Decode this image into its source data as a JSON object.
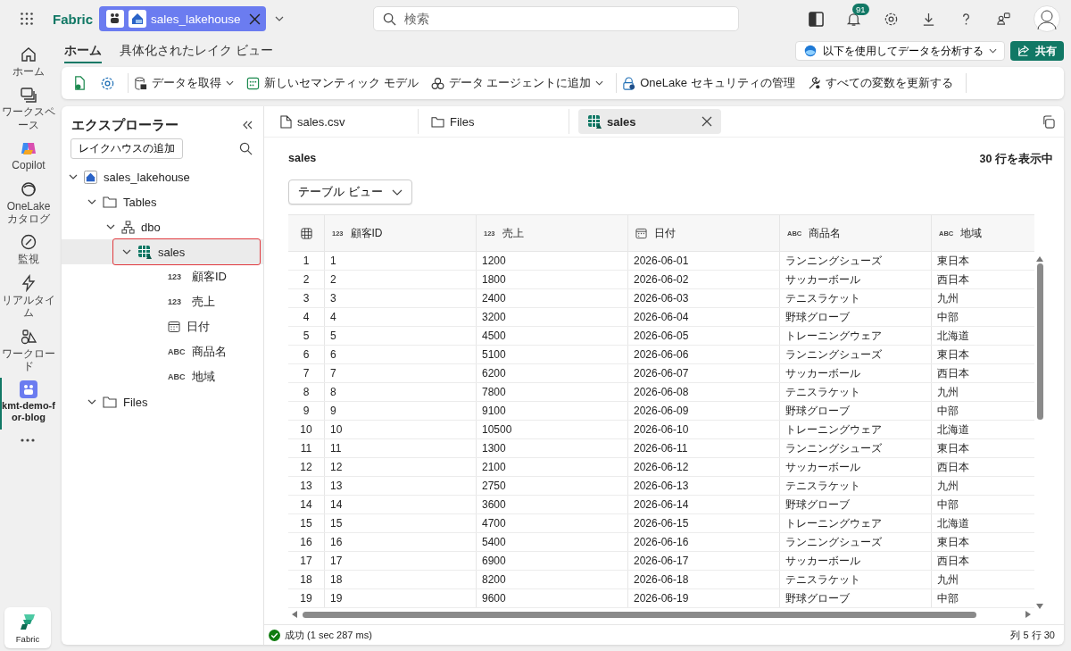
{
  "topbar": {
    "brand": "Fabric",
    "item_tab": {
      "label": "sales_lakehouse"
    },
    "search": {
      "placeholder": "検索"
    },
    "notifications": "91"
  },
  "rail": {
    "items": [
      {
        "label": "ホーム",
        "selected": false
      },
      {
        "label": "ワークスペース",
        "selected": false
      },
      {
        "label": "Copilot",
        "selected": false
      },
      {
        "label": "OneLake カタログ",
        "selected": false
      },
      {
        "label": "監視",
        "selected": false
      },
      {
        "label": "リアルタイム",
        "selected": false
      },
      {
        "label": "ワークロード",
        "selected": false
      },
      {
        "label": "kmt-demo-for-blog",
        "selected": true
      }
    ],
    "footer": "Fabric"
  },
  "ribbon_tabs": [
    {
      "label": "ホーム",
      "selected": true
    },
    {
      "label": "具体化されたレイク ビュー",
      "selected": false
    }
  ],
  "analyze_button": "以下を使用してデータを分析する",
  "share_button": "共有",
  "toolbar": [
    {
      "label": "データを取得",
      "dropdown": true
    },
    {
      "label": "新しいセマンティック モデル",
      "dropdown": false
    },
    {
      "label": "データ エージェントに追加",
      "dropdown": true
    },
    {
      "label": "OneLake セキュリティの管理",
      "dropdown": false
    },
    {
      "label": "すべての変数を更新する",
      "dropdown": false
    }
  ],
  "explorer": {
    "title": "エクスプローラー",
    "add_button": "レイクハウスの追加",
    "tree": [
      {
        "label": "sales_lakehouse",
        "kind": "lakehouse",
        "expanded": true,
        "selected": false,
        "children": [
          {
            "label": "Tables",
            "kind": "folder",
            "expanded": true,
            "selected": false,
            "children": [
              {
                "label": "dbo",
                "kind": "schema",
                "expanded": true,
                "selected": false,
                "children": [
                  {
                    "label": "sales",
                    "kind": "table",
                    "expanded": true,
                    "selected": true,
                    "children": [
                      {
                        "label": "顧客ID",
                        "kind": "column",
                        "type_label": "123",
                        "selected": false
                      },
                      {
                        "label": "売上",
                        "kind": "column",
                        "type_label": "123",
                        "selected": false
                      },
                      {
                        "label": "日付",
                        "kind": "date-column",
                        "selected": false
                      },
                      {
                        "label": "商品名",
                        "kind": "column",
                        "type_label": "ABC",
                        "selected": false
                      },
                      {
                        "label": "地域",
                        "kind": "column",
                        "type_label": "ABC",
                        "selected": false
                      }
                    ]
                  }
                ]
              }
            ]
          },
          {
            "label": "Files",
            "kind": "folder",
            "expanded": true,
            "selected": false
          }
        ]
      }
    ]
  },
  "doc_tabs": [
    {
      "label": "sales.csv",
      "kind": "file",
      "selected": false
    },
    {
      "label": "Files",
      "kind": "folder",
      "selected": false
    },
    {
      "label": "sales",
      "kind": "table",
      "selected": true
    }
  ],
  "preview": {
    "title": "sales",
    "row_count": "30 行を表示中",
    "view_select": "テーブル ビュー",
    "columns": [
      {
        "kind": "index"
      },
      {
        "name": "顧客ID",
        "kind": "number",
        "type_label": "123"
      },
      {
        "name": "売上",
        "kind": "number",
        "type_label": "123"
      },
      {
        "name": "日付",
        "kind": "date"
      },
      {
        "name": "商品名",
        "kind": "text",
        "type_label": "ABC"
      },
      {
        "name": "地域",
        "kind": "text",
        "type_label": "ABC"
      }
    ],
    "rows": [
      [
        "1",
        "1",
        "1200",
        "2026-06-01",
        "ランニングシューズ",
        "東日本"
      ],
      [
        "2",
        "2",
        "1800",
        "2026-06-02",
        "サッカーボール",
        "西日本"
      ],
      [
        "3",
        "3",
        "2400",
        "2026-06-03",
        "テニスラケット",
        "九州"
      ],
      [
        "4",
        "4",
        "3200",
        "2026-06-04",
        "野球グローブ",
        "中部"
      ],
      [
        "5",
        "5",
        "4500",
        "2026-06-05",
        "トレーニングウェア",
        "北海道"
      ],
      [
        "6",
        "6",
        "5100",
        "2026-06-06",
        "ランニングシューズ",
        "東日本"
      ],
      [
        "7",
        "7",
        "6200",
        "2026-06-07",
        "サッカーボール",
        "西日本"
      ],
      [
        "8",
        "8",
        "7800",
        "2026-06-08",
        "テニスラケット",
        "九州"
      ],
      [
        "9",
        "9",
        "9100",
        "2026-06-09",
        "野球グローブ",
        "中部"
      ],
      [
        "10",
        "10",
        "10500",
        "2026-06-10",
        "トレーニングウェア",
        "北海道"
      ],
      [
        "11",
        "11",
        "1300",
        "2026-06-11",
        "ランニングシューズ",
        "東日本"
      ],
      [
        "12",
        "12",
        "2100",
        "2026-06-12",
        "サッカーボール",
        "西日本"
      ],
      [
        "13",
        "13",
        "2750",
        "2026-06-13",
        "テニスラケット",
        "九州"
      ],
      [
        "14",
        "14",
        "3600",
        "2026-06-14",
        "野球グローブ",
        "中部"
      ],
      [
        "15",
        "15",
        "4700",
        "2026-06-15",
        "トレーニングウェア",
        "北海道"
      ],
      [
        "16",
        "16",
        "5400",
        "2026-06-16",
        "ランニングシューズ",
        "東日本"
      ],
      [
        "17",
        "17",
        "6900",
        "2026-06-17",
        "サッカーボール",
        "西日本"
      ],
      [
        "18",
        "18",
        "8200",
        "2026-06-18",
        "テニスラケット",
        "九州"
      ],
      [
        "19",
        "19",
        "9600",
        "2026-06-19",
        "野球グローブ",
        "中部"
      ]
    ]
  },
  "status_bar": {
    "message": "成功 (1 sec 287 ms)",
    "position": "列 5 行 30"
  }
}
